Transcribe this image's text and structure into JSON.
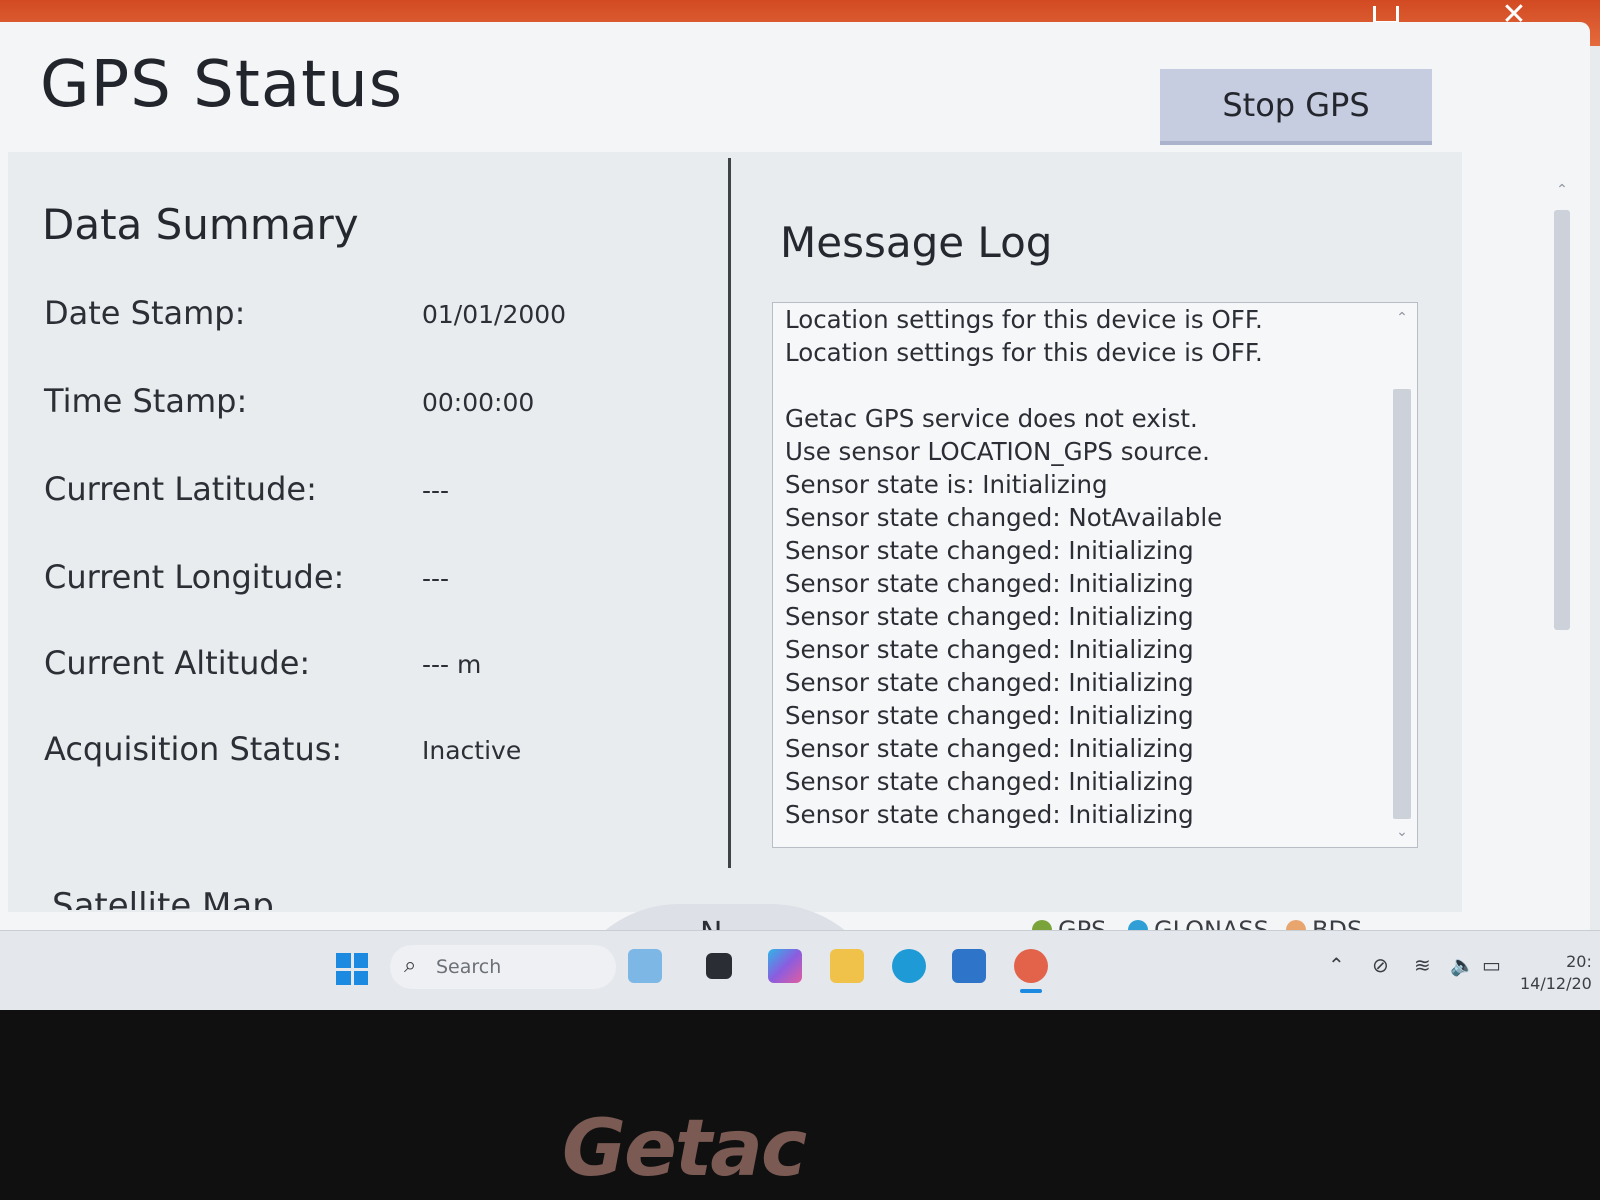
{
  "app": {
    "title": "GPS Status",
    "stop_button": "Stop GPS"
  },
  "data_summary": {
    "title": "Data Summary",
    "rows": [
      {
        "label": "Date Stamp:",
        "value": "01/01/2000"
      },
      {
        "label": "Time Stamp:",
        "value": "00:00:00"
      },
      {
        "label": "Current Latitude:",
        "value": "---"
      },
      {
        "label": "Current Longitude:",
        "value": "---"
      },
      {
        "label": "Current Altitude:",
        "value": "--- m"
      },
      {
        "label": "Acquisition Status:",
        "value": "Inactive"
      }
    ]
  },
  "message_log": {
    "title": "Message Log",
    "lines": [
      "Location settings for this device is OFF.",
      "Location settings for this device is OFF.",
      "",
      "Getac GPS service does not exist.",
      "Use sensor LOCATION_GPS source.",
      "Sensor state is: Initializing",
      "Sensor state changed: NotAvailable",
      "Sensor state changed: Initializing",
      "Sensor state changed: Initializing",
      "Sensor state changed: Initializing",
      "Sensor state changed: Initializing",
      "Sensor state changed: Initializing",
      "Sensor state changed: Initializing",
      "Sensor state changed: Initializing",
      "Sensor state changed: Initializing",
      "Sensor state changed: Initializing"
    ]
  },
  "satellite_map": {
    "title": "Satellite Map",
    "compass_label": "N",
    "legend": [
      {
        "label": "GPS",
        "color": "#7aa33a"
      },
      {
        "label": "GLONASS",
        "color": "#2f9fd6"
      },
      {
        "label": "BDS",
        "color": "#e8a66e"
      }
    ]
  },
  "taskbar": {
    "search_placeholder": "Search",
    "time": "20:",
    "date": "14/12/20"
  },
  "device": {
    "brand": "Getac"
  }
}
